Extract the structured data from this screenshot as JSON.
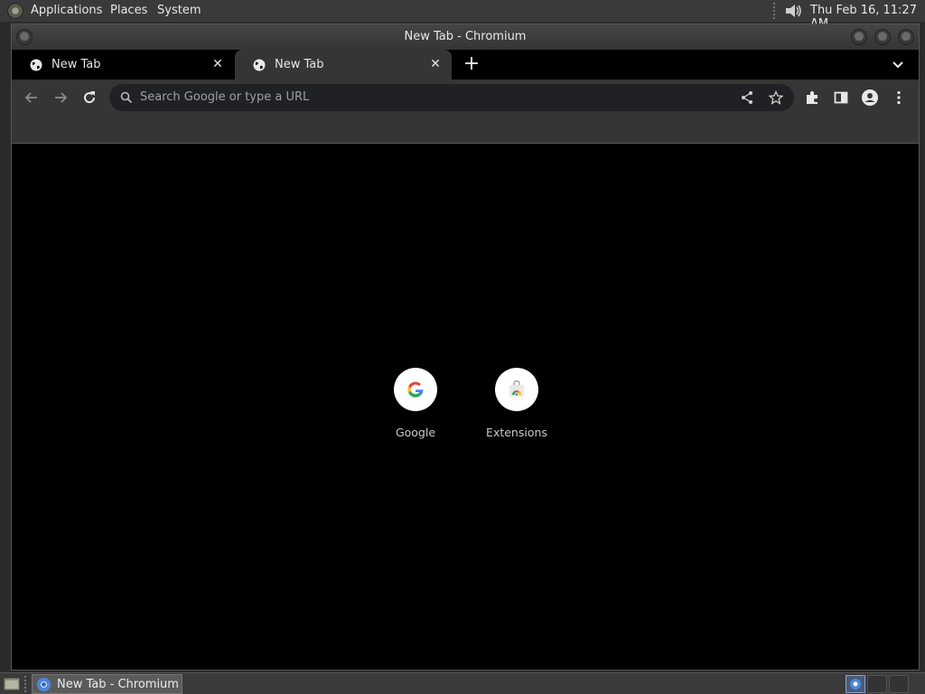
{
  "top_panel": {
    "menus": [
      "Applications",
      "Places",
      "System"
    ],
    "clock": "Thu Feb 16, 11:27 AM"
  },
  "window": {
    "title": "New Tab - Chromium"
  },
  "tabs": [
    {
      "title": "New Tab",
      "active": false
    },
    {
      "title": "New Tab",
      "active": true
    }
  ],
  "toolbar": {
    "omnibox_placeholder": "Search Google or type a URL"
  },
  "shortcuts": [
    {
      "label": "Google",
      "icon": "google-icon"
    },
    {
      "label": "Extensions",
      "icon": "chrome-web-store-icon"
    }
  ],
  "taskbar": {
    "task_label": "New Tab - Chromium"
  },
  "colors": {
    "panel": "#3a3a3a",
    "toolbar": "#353535",
    "omnibox": "#202124",
    "content": "#000000"
  }
}
